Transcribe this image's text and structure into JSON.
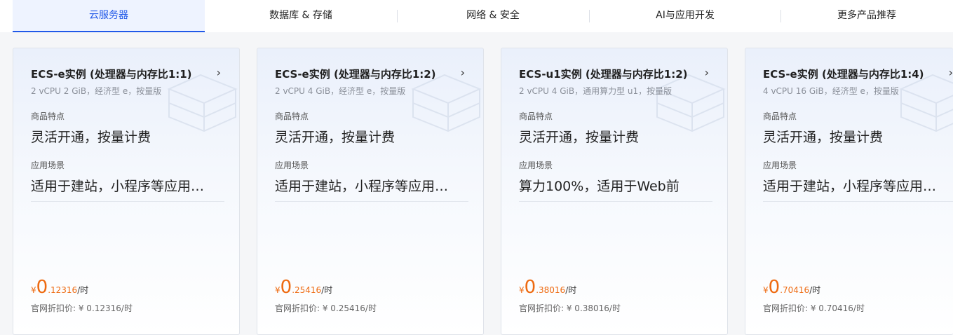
{
  "tabs": [
    {
      "label": "云服务器",
      "active": true
    },
    {
      "label": "数据库 & 存储",
      "active": false
    },
    {
      "label": "网络 & 安全",
      "active": false
    },
    {
      "label": "AI与应用开发",
      "active": false
    },
    {
      "label": "更多产品推荐",
      "active": false
    }
  ],
  "accent_color": "#2159e8",
  "price_color": "#ee6a10",
  "cards": [
    {
      "title": "ECS-e实例 (处理器与内存比1:1)",
      "subtitle": "2 vCPU 2 GiB，经济型 e，按量版",
      "feature_label": "商品特点",
      "feature": "灵活开通，按量计费",
      "scene_label": "应用场景",
      "scene": "适用于建站，小程序等应用…",
      "currency": "¥",
      "price_int": "0",
      "price_dec": ".12316",
      "unit": "/时",
      "official": "官网折扣价: ¥ 0.12316/时",
      "arrow": "›"
    },
    {
      "title": "ECS-e实例 (处理器与内存比1:2)",
      "subtitle": "2 vCPU 4 GiB，经济型 e，按量版",
      "feature_label": "商品特点",
      "feature": "灵活开通，按量计费",
      "scene_label": "应用场景",
      "scene": "适用于建站，小程序等应用…",
      "currency": "¥",
      "price_int": "0",
      "price_dec": ".25416",
      "unit": "/时",
      "official": "官网折扣价: ¥ 0.25416/时",
      "arrow": "›"
    },
    {
      "title": "ECS-u1实例 (处理器与内存比1:2)",
      "subtitle": "2 vCPU 4 GiB，通用算力型 u1，按量版",
      "feature_label": "商品特点",
      "feature": "灵活开通，按量计费",
      "scene_label": "应用场景",
      "scene": "算力100%，适用于Web前",
      "currency": "¥",
      "price_int": "0",
      "price_dec": ".38016",
      "unit": "/时",
      "official": "官网折扣价: ¥ 0.38016/时",
      "arrow": "›"
    },
    {
      "title": "ECS-e实例 (处理器与内存比1:4)",
      "subtitle": "4 vCPU 16 GiB，经济型 e，按量版",
      "feature_label": "商品特点",
      "feature": "灵活开通，按量计费",
      "scene_label": "应用场景",
      "scene": "适用于建站，小程序等应用…",
      "currency": "¥",
      "price_int": "0",
      "price_dec": ".70416",
      "unit": "/时",
      "official": "官网折扣价: ¥ 0.70416/时",
      "arrow": "›"
    }
  ]
}
